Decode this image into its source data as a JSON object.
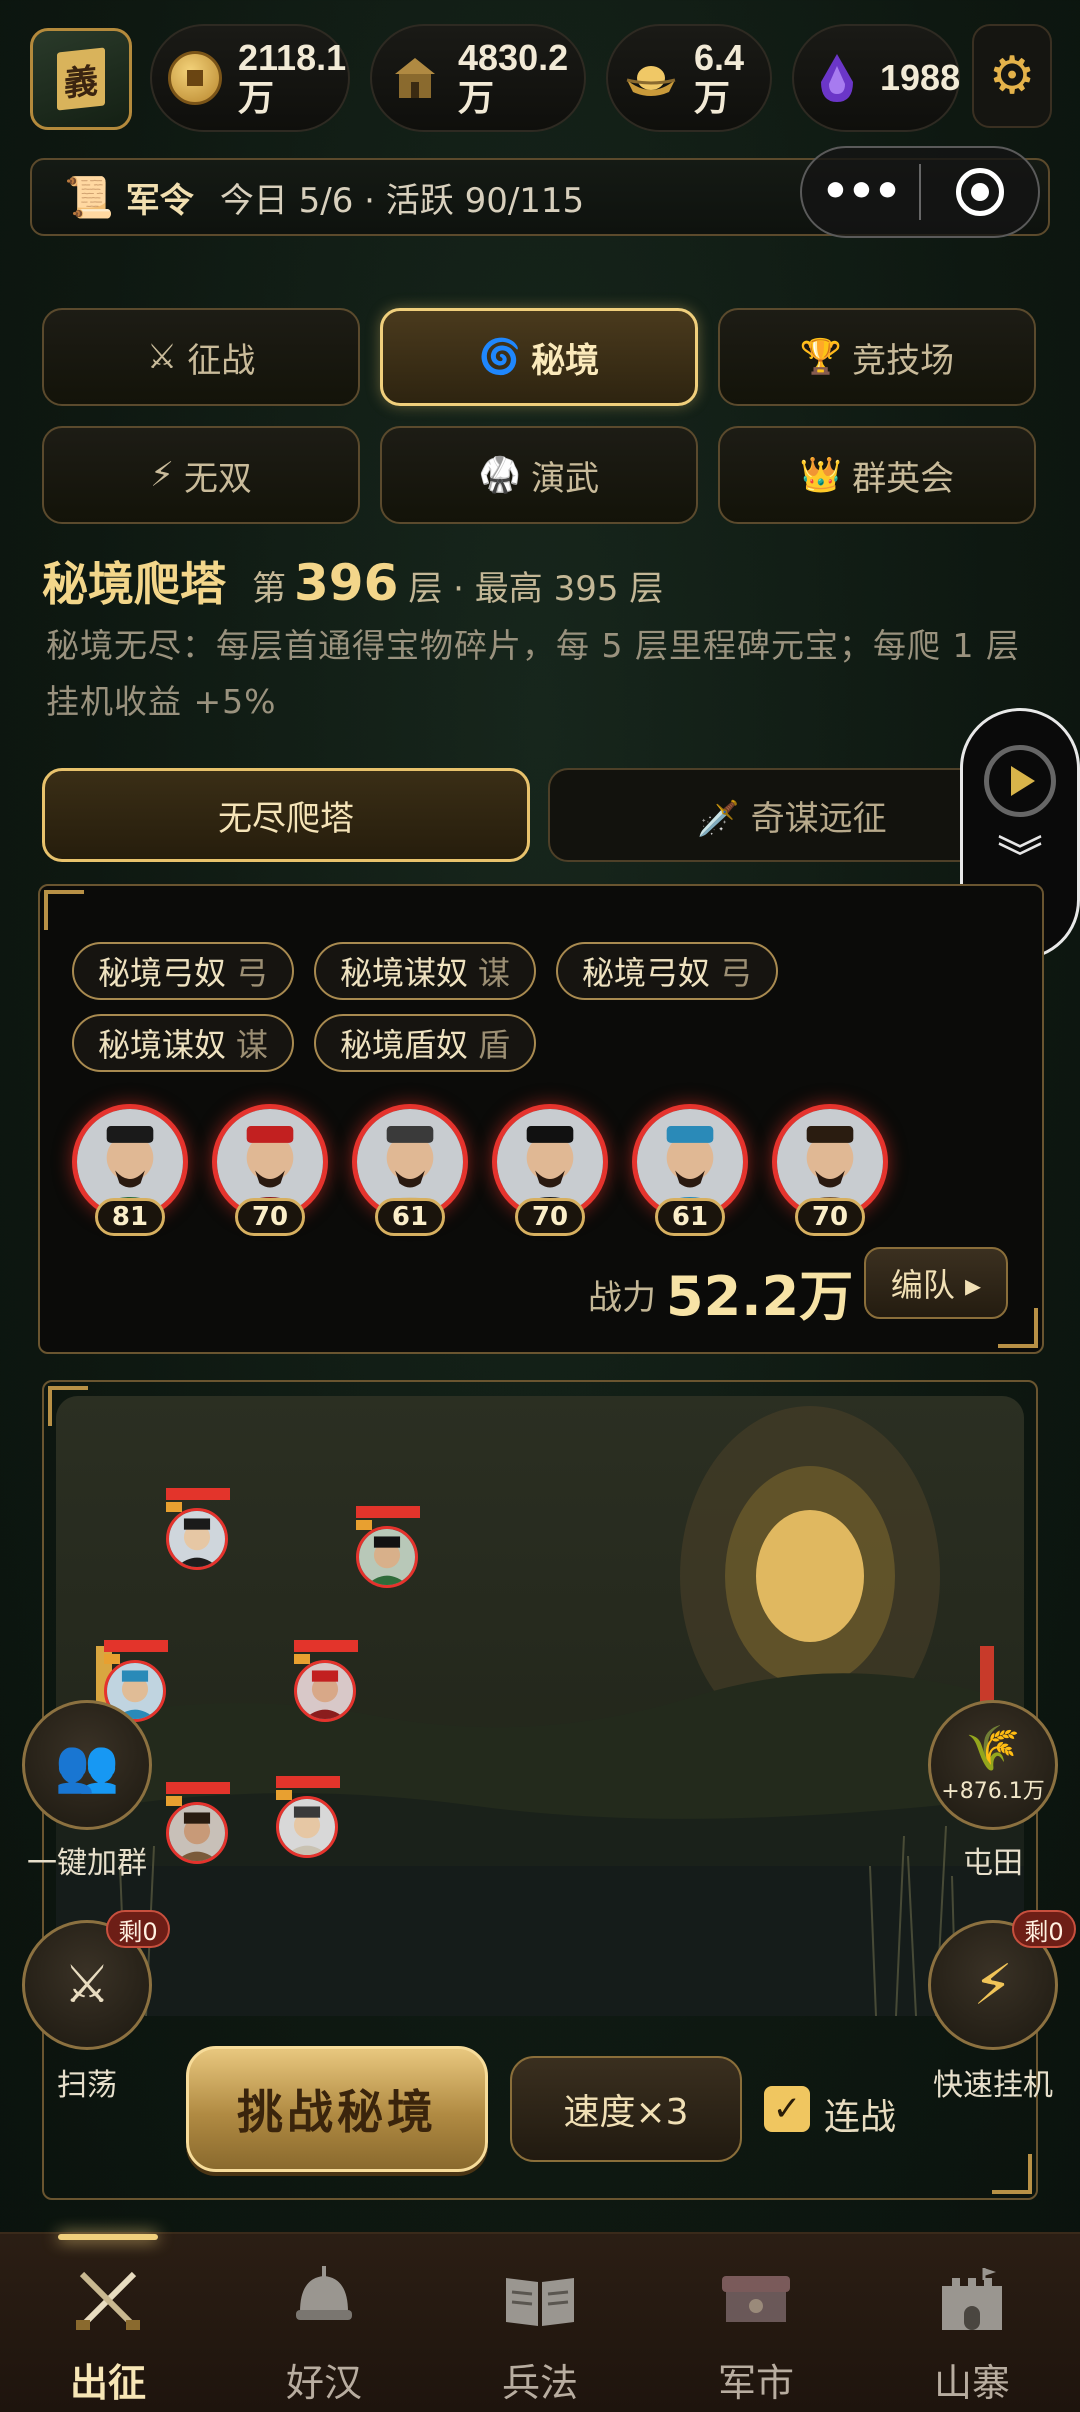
{
  "header": {
    "avatar_glyph": "義",
    "resources": [
      {
        "icon": "copper-coin-icon",
        "value": "2118.1\n万"
      },
      {
        "icon": "granary-icon",
        "value": "4830.2\n万"
      },
      {
        "icon": "gold-ingot-icon",
        "value": "6.4\n万"
      },
      {
        "icon": "purple-gem-icon",
        "value": "1988"
      }
    ]
  },
  "order_bar": {
    "label": "军令",
    "info": "今日 5/6 · 活跃 90/115"
  },
  "mode_tabs": [
    {
      "icon": "⚔",
      "label": "征战",
      "active": false
    },
    {
      "icon": "🌀",
      "label": "秘境",
      "active": true
    },
    {
      "icon": "🏆",
      "label": "竞技场",
      "active": false
    },
    {
      "icon": "⚡",
      "label": "无双",
      "active": false
    },
    {
      "icon": "🥋",
      "label": "演武",
      "active": false
    },
    {
      "icon": "👑",
      "label": "群英会",
      "active": false
    }
  ],
  "tower": {
    "title": "秘境爬塔",
    "floor_prefix": "第",
    "floor": "396",
    "floor_suffix": "层 · 最高 395 层",
    "desc": "秘境无尽：每层首通得宝物碎片，每 5 层里程碑元宝；每爬 1 层挂机收益 +5%"
  },
  "sub_tabs": {
    "endless": "无尽爬塔",
    "expedition": "🗡️ 奇谋远征"
  },
  "enemy_tags": [
    {
      "name": "秘境弓奴",
      "cls": "弓"
    },
    {
      "name": "秘境谋奴",
      "cls": "谋"
    },
    {
      "name": "秘境弓奴",
      "cls": "弓"
    },
    {
      "name": "秘境谋奴",
      "cls": "谋"
    },
    {
      "name": "秘境盾奴",
      "cls": "盾"
    }
  ],
  "heroes": [
    {
      "level": "81",
      "robe": "#2f6b3a",
      "hat": "#1a1a1a"
    },
    {
      "level": "70",
      "robe": "#8a1d1d",
      "hat": "#c22020"
    },
    {
      "level": "61",
      "robe": "#c9c2b2",
      "hat": "#3a3a3a"
    },
    {
      "level": "70",
      "robe": "#1d1d1d",
      "hat": "#111111"
    },
    {
      "level": "61",
      "robe": "#2a8ab8",
      "hat": "#2a8ab8"
    },
    {
      "level": "70",
      "robe": "#7a5a3a",
      "hat": "#2a1c10"
    }
  ],
  "power": {
    "label": "战力",
    "value": "52.2万",
    "formation_label": "编队 ▸"
  },
  "side_actions": {
    "group_label": "一键加群",
    "farm_value": "+876.1万",
    "farm_label": "屯田",
    "sweep_label": "扫荡",
    "sweep_remain": "剩0",
    "quick_label": "快速挂机",
    "quick_remain": "剩0"
  },
  "battle": {
    "challenge_label": "挑战秘境",
    "speed_label": "速度×3",
    "chain_label": "连战",
    "chain_checked": true
  },
  "bottom_nav": [
    {
      "icon": "crossed-swords-icon",
      "label": "出征",
      "active": true
    },
    {
      "icon": "helmet-icon",
      "label": "好汉",
      "active": false
    },
    {
      "icon": "book-icon",
      "label": "兵法",
      "active": false
    },
    {
      "icon": "market-stall-icon",
      "label": "军市",
      "active": false
    },
    {
      "icon": "fortress-icon",
      "label": "山寨",
      "active": false
    }
  ]
}
